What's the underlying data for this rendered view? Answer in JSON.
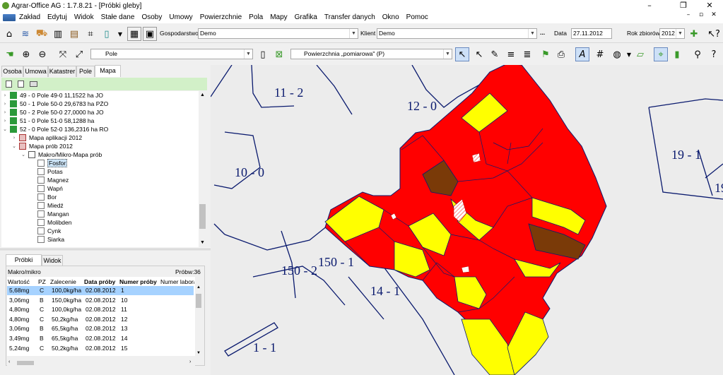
{
  "window": {
    "title": "Agrar-Office AG : 1.7.8.21 - [Próbki gleby]",
    "minimize": "–",
    "maximize": "❐",
    "close": "✕"
  },
  "menu": {
    "items": [
      "Zakład",
      "Edytuj",
      "Widok",
      "Stałe dane",
      "Osoby",
      "Umowy",
      "Powierzchnie",
      "Pola",
      "Mapy",
      "Grafika",
      "Transfer danych",
      "Okno",
      "Pomoc"
    ]
  },
  "toolbar1": {
    "gospodarstwo_label": "Gospodarstwo",
    "gospodarstwo_value": "Demo",
    "klient_label": "Klient",
    "klient_value": "Demo",
    "dots": "...",
    "data_label": "Data",
    "data_value": "27.11.2012",
    "rok_label": "Rok zbiorów",
    "rok_value": "2012"
  },
  "toolbar2": {
    "layer_value": "Pole",
    "surface_value": "Powierzchnia „pomiarowa\" (P)"
  },
  "left_tabs": [
    "Osoba",
    "Umowa",
    "Katastrer",
    "Pole",
    "Mapa"
  ],
  "left_tabs_active": 4,
  "tree": [
    {
      "text": "49 - 0 Pole 49-0 11,1522 ha JO"
    },
    {
      "text": "50 - 1 Pole 50-0 29,6783 ha PŻO"
    },
    {
      "text": "50 - 2 Pole 50-0 27,0000 ha JO"
    },
    {
      "text": "51 - 0 Pole 51-0 58,1288 ha"
    },
    {
      "text": "52 - 0 Pole 52-0 136,2316 ha RO"
    },
    {
      "text": "Mapa aplikacji 2012"
    },
    {
      "text": "Mapa prób 2012"
    },
    {
      "text": "Makro/Mikro-Mapa prób"
    },
    {
      "text": "Fosfor"
    },
    {
      "text": "Potas"
    },
    {
      "text": "Magnez"
    },
    {
      "text": "Wapń"
    },
    {
      "text": "Bor"
    },
    {
      "text": "Miedź"
    },
    {
      "text": "Mangan"
    },
    {
      "text": "Molibden"
    },
    {
      "text": "Cynk"
    },
    {
      "text": "Siarka"
    }
  ],
  "bottom_tabs": [
    "Próbki gleby",
    "Widok"
  ],
  "samples": {
    "group": "Makro/mikro",
    "count": "Próbw:36",
    "headers": [
      "Wartość",
      "PZ",
      "Zalecenie",
      "Data próby",
      "Numer próby",
      "Numer labora"
    ],
    "rows": [
      [
        "5,68mg",
        "C",
        "100,0kg/ha",
        "02.08.2012",
        "1"
      ],
      [
        "3,06mg",
        "B",
        "150,0kg/ha",
        "02.08.2012",
        "10"
      ],
      [
        "4,80mg",
        "C",
        "100,0kg/ha",
        "02.08.2012",
        "11"
      ],
      [
        "4,80mg",
        "C",
        "50,2kg/ha",
        "02.08.2012",
        "12"
      ],
      [
        "3,06mg",
        "B",
        "65,5kg/ha",
        "02.08.2012",
        "13"
      ],
      [
        "3,49mg",
        "B",
        "65,5kg/ha",
        "02.08.2012",
        "14"
      ],
      [
        "5,24mg",
        "C",
        "50,2kg/ha",
        "02.08.2012",
        "15"
      ]
    ]
  },
  "map": {
    "labels": [
      "11 - 2",
      "12 - 0",
      "10 - 0",
      "19 - 1",
      "19",
      "150 - 2",
      "150 - 1",
      "14 - 1",
      "1 - 1"
    ],
    "colors": {
      "red": "#ff0000",
      "yellow": "#ffff00",
      "brown": "#7a3a08",
      "line": "#0a1a6e"
    }
  }
}
